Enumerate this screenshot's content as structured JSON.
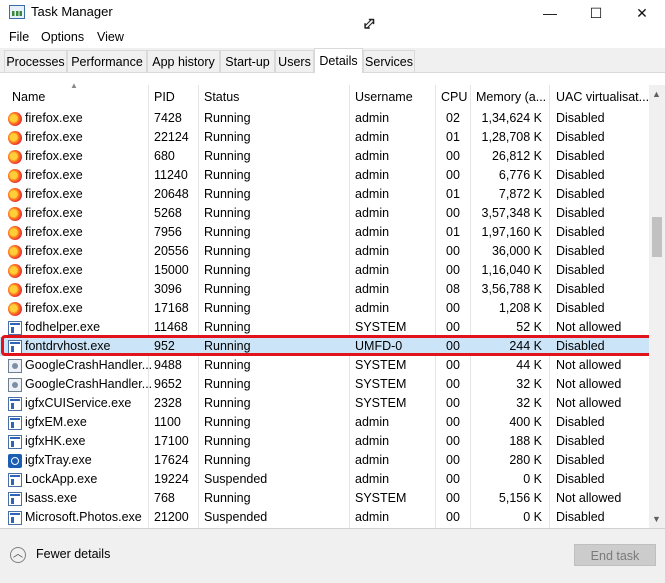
{
  "window": {
    "title": "Task Manager",
    "minimize": "—",
    "maximize": "☐",
    "close": "✕",
    "resize_cursor": "⇕"
  },
  "menu": [
    "File",
    "Options",
    "View"
  ],
  "tabs": [
    "Processes",
    "Performance",
    "App history",
    "Start-up",
    "Users",
    "Details",
    "Services"
  ],
  "active_tab": "Details",
  "columns": [
    "Name",
    "PID",
    "Status",
    "Username",
    "CPU",
    "Memory (a...",
    "UAC virtualisat..."
  ],
  "rows": [
    {
      "icon": "firefox-icon",
      "name": "firefox.exe",
      "pid": "7428",
      "status": "Running",
      "user": "admin",
      "cpu": "02",
      "mem": "1,34,624 K",
      "uac": "Disabled"
    },
    {
      "icon": "firefox-icon",
      "name": "firefox.exe",
      "pid": "22124",
      "status": "Running",
      "user": "admin",
      "cpu": "01",
      "mem": "1,28,708 K",
      "uac": "Disabled"
    },
    {
      "icon": "firefox-icon",
      "name": "firefox.exe",
      "pid": "680",
      "status": "Running",
      "user": "admin",
      "cpu": "00",
      "mem": "26,812 K",
      "uac": "Disabled"
    },
    {
      "icon": "firefox-icon",
      "name": "firefox.exe",
      "pid": "11240",
      "status": "Running",
      "user": "admin",
      "cpu": "00",
      "mem": "6,776 K",
      "uac": "Disabled"
    },
    {
      "icon": "firefox-icon",
      "name": "firefox.exe",
      "pid": "20648",
      "status": "Running",
      "user": "admin",
      "cpu": "01",
      "mem": "7,872 K",
      "uac": "Disabled"
    },
    {
      "icon": "firefox-icon",
      "name": "firefox.exe",
      "pid": "5268",
      "status": "Running",
      "user": "admin",
      "cpu": "00",
      "mem": "3,57,348 K",
      "uac": "Disabled"
    },
    {
      "icon": "firefox-icon",
      "name": "firefox.exe",
      "pid": "7956",
      "status": "Running",
      "user": "admin",
      "cpu": "01",
      "mem": "1,97,160 K",
      "uac": "Disabled"
    },
    {
      "icon": "firefox-icon",
      "name": "firefox.exe",
      "pid": "20556",
      "status": "Running",
      "user": "admin",
      "cpu": "00",
      "mem": "36,000 K",
      "uac": "Disabled"
    },
    {
      "icon": "firefox-icon",
      "name": "firefox.exe",
      "pid": "15000",
      "status": "Running",
      "user": "admin",
      "cpu": "00",
      "mem": "1,16,040 K",
      "uac": "Disabled"
    },
    {
      "icon": "firefox-icon",
      "name": "firefox.exe",
      "pid": "3096",
      "status": "Running",
      "user": "admin",
      "cpu": "08",
      "mem": "3,56,788 K",
      "uac": "Disabled"
    },
    {
      "icon": "firefox-icon",
      "name": "firefox.exe",
      "pid": "17168",
      "status": "Running",
      "user": "admin",
      "cpu": "00",
      "mem": "1,208 K",
      "uac": "Disabled"
    },
    {
      "icon": "window-icon",
      "name": "fodhelper.exe",
      "pid": "11468",
      "status": "Running",
      "user": "SYSTEM",
      "cpu": "00",
      "mem": "52 K",
      "uac": "Not allowed"
    },
    {
      "icon": "window-icon",
      "name": "fontdrvhost.exe",
      "pid": "952",
      "status": "Running",
      "user": "UMFD-0",
      "cpu": "00",
      "mem": "244 K",
      "uac": "Disabled",
      "selected": true
    },
    {
      "icon": "crash-handler-icon",
      "name": "GoogleCrashHandler...",
      "pid": "9488",
      "status": "Running",
      "user": "SYSTEM",
      "cpu": "00",
      "mem": "44 K",
      "uac": "Not allowed"
    },
    {
      "icon": "crash-handler-icon",
      "name": "GoogleCrashHandler...",
      "pid": "9652",
      "status": "Running",
      "user": "SYSTEM",
      "cpu": "00",
      "mem": "32 K",
      "uac": "Not allowed"
    },
    {
      "icon": "window-icon",
      "name": "igfxCUIService.exe",
      "pid": "2328",
      "status": "Running",
      "user": "SYSTEM",
      "cpu": "00",
      "mem": "32 K",
      "uac": "Not allowed"
    },
    {
      "icon": "window-icon",
      "name": "igfxEM.exe",
      "pid": "1100",
      "status": "Running",
      "user": "admin",
      "cpu": "00",
      "mem": "400 K",
      "uac": "Disabled"
    },
    {
      "icon": "window-icon",
      "name": "igfxHK.exe",
      "pid": "17100",
      "status": "Running",
      "user": "admin",
      "cpu": "00",
      "mem": "188 K",
      "uac": "Disabled"
    },
    {
      "icon": "intel-graphics-icon",
      "name": "igfxTray.exe",
      "pid": "17624",
      "status": "Running",
      "user": "admin",
      "cpu": "00",
      "mem": "280 K",
      "uac": "Disabled"
    },
    {
      "icon": "window-icon",
      "name": "LockApp.exe",
      "pid": "19224",
      "status": "Suspended",
      "user": "admin",
      "cpu": "00",
      "mem": "0 K",
      "uac": "Disabled"
    },
    {
      "icon": "window-icon",
      "name": "lsass.exe",
      "pid": "768",
      "status": "Running",
      "user": "SYSTEM",
      "cpu": "00",
      "mem": "5,156 K",
      "uac": "Not allowed"
    },
    {
      "icon": "window-icon",
      "name": "Microsoft.Photos.exe",
      "pid": "21200",
      "status": "Suspended",
      "user": "admin",
      "cpu": "00",
      "mem": "0 K",
      "uac": "Disabled"
    }
  ],
  "footer": {
    "fewer_details": "Fewer details",
    "end_task": "End task"
  },
  "colors": {
    "selection": "#cce4f7",
    "highlight_box": "#e0141a"
  }
}
